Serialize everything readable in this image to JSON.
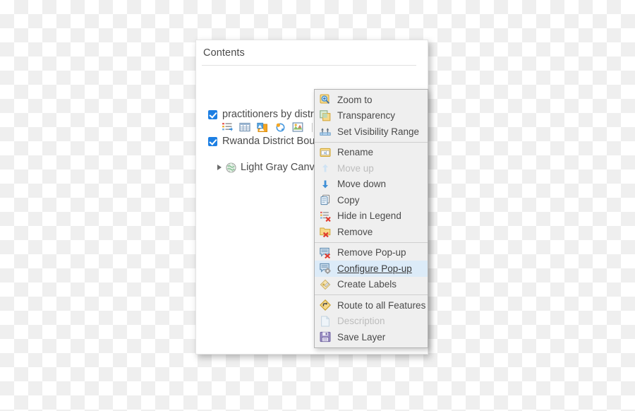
{
  "panel": {
    "title": "Contents",
    "layers": [
      {
        "label": "practitioners by district",
        "checked": true,
        "tools": [
          {
            "name": "legend-icon",
            "title": "Show Legend"
          },
          {
            "name": "table-icon",
            "title": "Show Table"
          },
          {
            "name": "change-style-icon",
            "title": "Change Style"
          },
          {
            "name": "filter-icon",
            "title": "Filter"
          },
          {
            "name": "analysis-icon",
            "title": "Perform Analysis"
          }
        ],
        "more_label": "more-options"
      },
      {
        "label": "Rwanda District Bound",
        "checked": true
      }
    ],
    "basemap": {
      "label": "Light Gray Canvas",
      "expander": "collapsed"
    }
  },
  "context_menu": {
    "groups": [
      {
        "items": [
          {
            "label": "Zoom to",
            "icon": "zoom-to-icon",
            "state": "normal"
          },
          {
            "label": "Transparency",
            "icon": "transparency-icon",
            "state": "normal"
          },
          {
            "label": "Set Visibility Range",
            "icon": "visibility-range-icon",
            "state": "normal"
          }
        ]
      },
      {
        "items": [
          {
            "label": "Rename",
            "icon": "rename-icon",
            "state": "normal"
          },
          {
            "label": "Move up",
            "icon": "arrow-up-icon",
            "state": "disabled"
          },
          {
            "label": "Move down",
            "icon": "arrow-down-icon",
            "state": "normal"
          },
          {
            "label": "Copy",
            "icon": "copy-icon",
            "state": "normal"
          },
          {
            "label": "Hide in Legend",
            "icon": "hide-in-legend-icon",
            "state": "normal"
          },
          {
            "label": "Remove",
            "icon": "remove-icon",
            "state": "normal"
          }
        ]
      },
      {
        "items": [
          {
            "label": "Remove Pop-up",
            "icon": "remove-popup-icon",
            "state": "normal"
          },
          {
            "label": "Configure Pop-up",
            "icon": "configure-popup-icon",
            "state": "highlighted"
          },
          {
            "label": "Create Labels",
            "icon": "create-labels-icon",
            "state": "normal"
          }
        ]
      },
      {
        "items": [
          {
            "label": "Route to all Features",
            "icon": "route-icon",
            "state": "normal"
          },
          {
            "label": "Description",
            "icon": "description-icon",
            "state": "disabled"
          },
          {
            "label": "Save Layer",
            "icon": "save-layer-icon",
            "state": "normal"
          }
        ]
      }
    ]
  },
  "colors": {
    "accent": "#1d7fe3",
    "highlight": "#dcebf8",
    "text": "#4a4a4a",
    "disabled_text": "#bdbdbd",
    "panel_bg": "#ffffff",
    "menu_bg": "#efefef"
  }
}
